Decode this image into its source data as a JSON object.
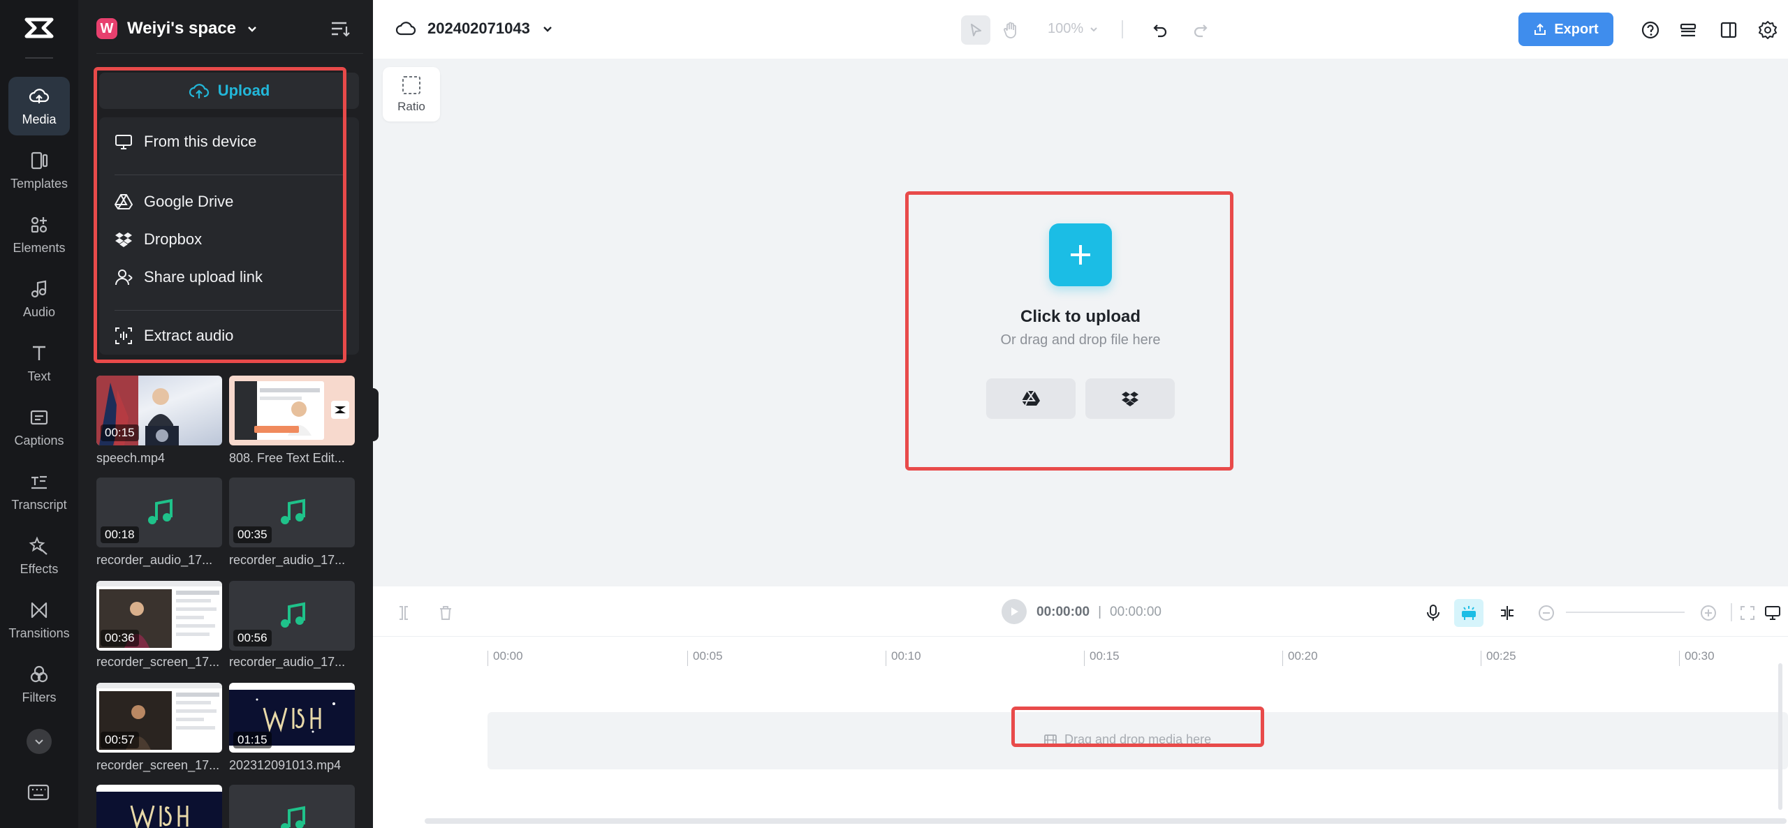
{
  "rail": {
    "items": [
      {
        "label": "Media",
        "icon": "cloud-upload-icon"
      },
      {
        "label": "Templates",
        "icon": "templates-icon"
      },
      {
        "label": "Elements",
        "icon": "elements-icon"
      },
      {
        "label": "Audio",
        "icon": "music-note-icon"
      },
      {
        "label": "Text",
        "icon": "text-icon"
      },
      {
        "label": "Captions",
        "icon": "captions-icon"
      },
      {
        "label": "Transcript",
        "icon": "transcript-icon"
      },
      {
        "label": "Effects",
        "icon": "effects-icon"
      },
      {
        "label": "Transitions",
        "icon": "transitions-icon"
      },
      {
        "label": "Filters",
        "icon": "filters-icon"
      }
    ]
  },
  "panel": {
    "space_initial": "W",
    "space_name": "Weiyi's space",
    "upload_label": "Upload",
    "menu": {
      "from_device": "From this device",
      "google_drive": "Google Drive",
      "dropbox": "Dropbox",
      "share_link": "Share upload link",
      "extract_audio": "Extract audio"
    },
    "media": [
      {
        "name": "speech.mp4",
        "duration": "00:15",
        "kind": "video"
      },
      {
        "name": "808. Free Text Edit...",
        "duration": "",
        "kind": "video"
      },
      {
        "name": "recorder_audio_17...",
        "duration": "00:18",
        "kind": "audio"
      },
      {
        "name": "recorder_audio_17...",
        "duration": "00:35",
        "kind": "audio"
      },
      {
        "name": "recorder_screen_17...",
        "duration": "00:36",
        "kind": "video"
      },
      {
        "name": "recorder_audio_17...",
        "duration": "00:56",
        "kind": "audio"
      },
      {
        "name": "recorder_screen_17...",
        "duration": "00:57",
        "kind": "video"
      },
      {
        "name": "202312091013.mp4",
        "duration": "01:15",
        "kind": "video"
      }
    ]
  },
  "topbar": {
    "project_name": "202402071043",
    "zoom": "100%",
    "export_label": "Export"
  },
  "canvas": {
    "ratio_label": "Ratio",
    "upload_title": "Click to upload",
    "upload_sub": "Or drag and drop file here"
  },
  "timeline": {
    "current_time": "00:00:00",
    "total_time": "00:00:00",
    "ruler": [
      "00:00",
      "00:05",
      "00:10",
      "00:15",
      "00:20",
      "00:25",
      "00:30"
    ],
    "drop_hint": "Drag and drop media here"
  },
  "colors": {
    "accent": "#1bbde5",
    "export": "#3f8ded",
    "highlight": "#e84a4a"
  }
}
